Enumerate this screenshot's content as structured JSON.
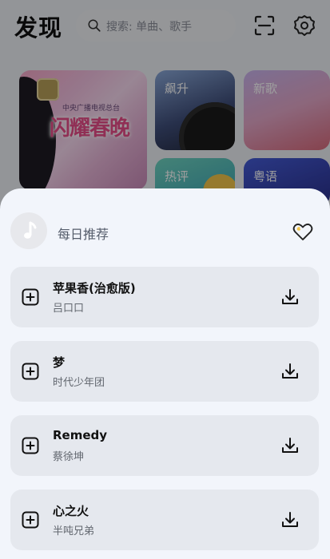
{
  "header": {
    "title": "发现",
    "search_placeholder": "搜索: 单曲、歌手",
    "icons": [
      "search-icon",
      "scan-icon",
      "gear-icon"
    ]
  },
  "banner": {
    "headline": "闪耀春晚",
    "caption": "中央广播电视总台"
  },
  "tiles": [
    {
      "label": "飙升"
    },
    {
      "label": "新歌"
    },
    {
      "label": "热评"
    },
    {
      "label": "粤语"
    }
  ],
  "sheet": {
    "title": "每日推荐",
    "songs": [
      {
        "title": "苹果香(治愈版)",
        "artist": "吕口口"
      },
      {
        "title": "梦",
        "artist": "时代少年团"
      },
      {
        "title": "Remedy",
        "artist": "蔡徐坤"
      },
      {
        "title": "心之火",
        "artist": "半吨兄弟"
      }
    ]
  },
  "colors": {
    "accent": "#f2c54a",
    "sheet_bg": "#f2f5fb",
    "card_bg": "#e5e8ee"
  }
}
